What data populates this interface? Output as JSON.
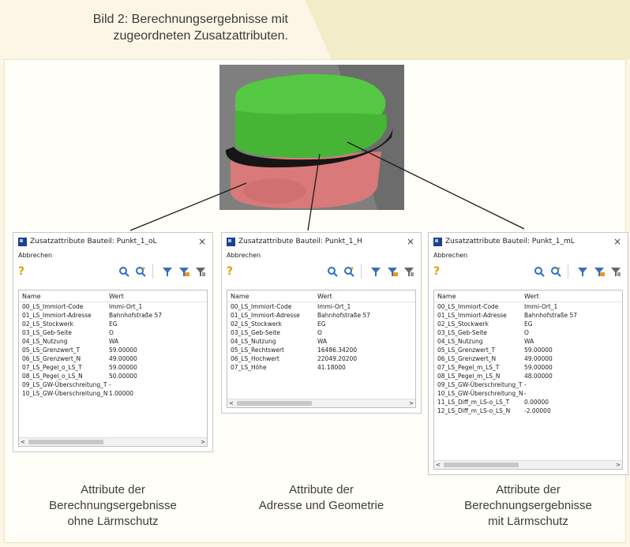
{
  "caption": {
    "line1": "Bild 2: Berechnungsergebnisse mit",
    "line2": "zugeordneten Zusatzattributen."
  },
  "colors": {
    "green_top": "#4fbf3a",
    "green_side": "#3a9e2a",
    "band": "#151515",
    "pink": "#d9797a",
    "grey_bg": "#7f7f7f"
  },
  "icons": [
    "app-icon",
    "close-icon",
    "help-icon",
    "zoom-in-icon",
    "zoom-fit-icon",
    "filter-icon",
    "filter-add-icon",
    "filter-clear-icon"
  ],
  "windows": [
    {
      "title": "Zusatzattribute Bauteil: Punkt_1_oL",
      "menu": "Abbrechen",
      "help": "?",
      "close": "×",
      "col_name": "Name",
      "col_value": "Wert",
      "rows": [
        {
          "name": "00_LS_Immiort-Code",
          "value": "Immi-Ort_1"
        },
        {
          "name": "01_LS_Immiort-Adresse",
          "value": "Bahnhofstraße 57"
        },
        {
          "name": "02_LS_Stockwerk",
          "value": "EG"
        },
        {
          "name": "03_LS_Geb-Seite",
          "value": "O"
        },
        {
          "name": "04_LS_Nutzung",
          "value": "WA"
        },
        {
          "name": "05_LS_Grenzwert_T",
          "value": "59.00000"
        },
        {
          "name": "06_LS_Grenzwert_N",
          "value": "49.00000"
        },
        {
          "name": "07_LS_Pegel_o_LS_T",
          "value": "59.00000"
        },
        {
          "name": "08_LS_Pegel_o_LS_N",
          "value": "50.00000"
        },
        {
          "name": "09_LS_GW-Überschreitung_T",
          "value": "-"
        },
        {
          "name": "10_LS_GW-Überschreitung_N",
          "value": "1.00000"
        }
      ],
      "scroll_left": "<",
      "scroll_right": ">"
    },
    {
      "title": "Zusatzattribute Bauteil: Punkt_1_H",
      "menu": "Abbrechen",
      "help": "?",
      "close": "×",
      "col_name": "Name",
      "col_value": "Wert",
      "rows": [
        {
          "name": "00_LS_Immiort-Code",
          "value": "Immi-Ort_1"
        },
        {
          "name": "01_LS_Immiort-Adresse",
          "value": "Bahnhofstraße 57"
        },
        {
          "name": "02_LS_Stockwerk",
          "value": "EG"
        },
        {
          "name": "03_LS_Geb-Seite",
          "value": "O"
        },
        {
          "name": "04_LS_Nutzung",
          "value": "WA"
        },
        {
          "name": "05_LS_Rechtswert",
          "value": "16486.34200"
        },
        {
          "name": "06_LS_Hochwert",
          "value": "22049.20200"
        },
        {
          "name": "07_LS_Höhe",
          "value": "41.18000"
        }
      ],
      "scroll_left": "<",
      "scroll_right": ">"
    },
    {
      "title": "Zusatzattribute Bauteil: Punkt_1_mL",
      "menu": "Abbrechen",
      "help": "?",
      "close": "×",
      "col_name": "Name",
      "col_value": "Wert",
      "rows": [
        {
          "name": "00_LS_Immiort-Code",
          "value": "Immi-Ort_1"
        },
        {
          "name": "01_LS_Immiort-Adresse",
          "value": "Bahnhofstraße 57"
        },
        {
          "name": "02_LS_Stockwerk",
          "value": "EG"
        },
        {
          "name": "03_LS_Geb-Seite",
          "value": "O"
        },
        {
          "name": "04_LS_Nutzung",
          "value": "WA"
        },
        {
          "name": "05_LS_Grenzwert_T",
          "value": "59.00000"
        },
        {
          "name": "06_LS_Grenzwert_N",
          "value": "49.00000"
        },
        {
          "name": "07_LS_Pegel_m_LS_T",
          "value": "59.00000"
        },
        {
          "name": "08_LS_Pegel_m_LS_N",
          "value": "48.00000"
        },
        {
          "name": "09_LS_GW-Überschreitung_T",
          "value": "-"
        },
        {
          "name": "10_LS_GW-Überschreitung_N",
          "value": "-"
        },
        {
          "name": "11_LS_Diff_m_LS-o_LS_T",
          "value": "0.00000"
        },
        {
          "name": "12_LS_Diff_m_LS-o_LS_N",
          "value": "-2.00000"
        }
      ],
      "scroll_left": "<",
      "scroll_right": ">"
    }
  ],
  "labels": [
    [
      "Attribute der",
      "Berechnungsergebnisse",
      "ohne Lärmschutz"
    ],
    [
      "Attribute der",
      "Adresse und Geometrie"
    ],
    [
      "Attribute der",
      "Berechnungsergebnisse",
      "mit Lärmschutz"
    ]
  ]
}
